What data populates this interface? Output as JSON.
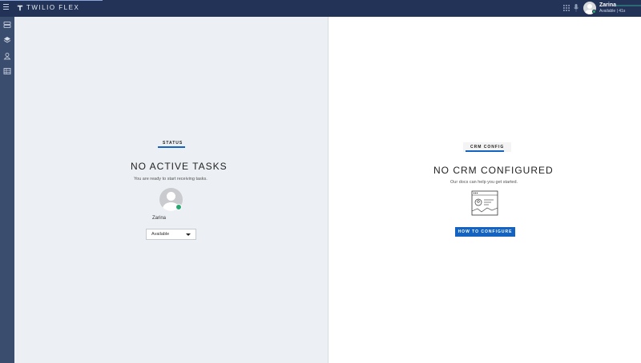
{
  "header": {
    "logo_text": "TWILIO FLEX",
    "user_name": "Zarina",
    "user_status": "Available | 41s"
  },
  "sidebar": {
    "items": [
      {
        "icon": "tasks-icon"
      },
      {
        "icon": "layers-icon"
      },
      {
        "icon": "supervisor-icon"
      },
      {
        "icon": "directory-icon"
      }
    ]
  },
  "status_panel": {
    "tab_label": "STATUS",
    "title": "NO ACTIVE TASKS",
    "subtitle": "You are ready to start receiving tasks.",
    "agent_name": "Zarina",
    "activity_selected": "Available"
  },
  "crm_panel": {
    "tab_label": "CRM CONFIG",
    "title": "NO CRM CONFIGURED",
    "subtitle": "Our docs can help you get started.",
    "button_label": "HOW TO CONFIGURE"
  },
  "colors": {
    "topbar": "#223357",
    "sidebar": "#3b4d6e",
    "accent": "#1463c0",
    "available": "#2aa76f"
  }
}
